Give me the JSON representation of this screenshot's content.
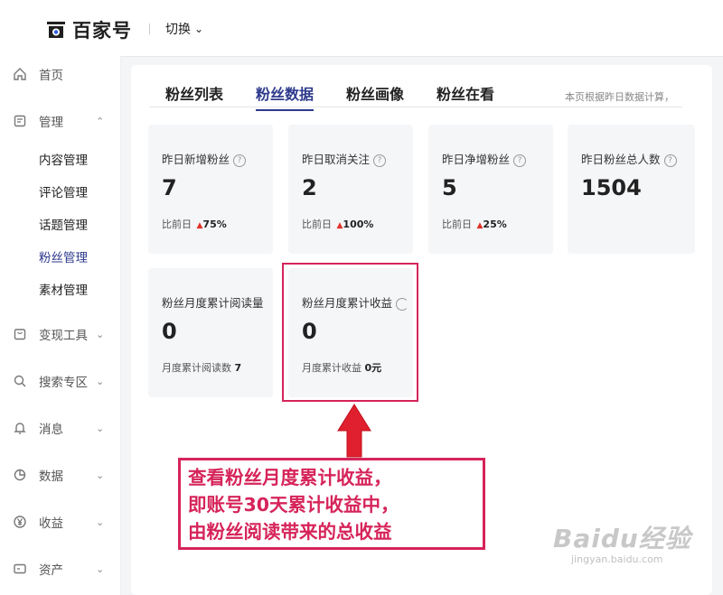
{
  "header": {
    "brand": "百家号",
    "switch_label": "切换"
  },
  "sidebar": {
    "home": "首页",
    "manage": "管理",
    "sub_items": [
      "内容管理",
      "评论管理",
      "话题管理",
      "粉丝管理",
      "素材管理"
    ],
    "monetize": "变现工具",
    "search": "搜索专区",
    "messages": "消息",
    "data": "数据",
    "income": "收益",
    "assets": "资产"
  },
  "tabs": [
    "粉丝列表",
    "粉丝数据",
    "粉丝画像",
    "粉丝在看"
  ],
  "active_tab": "粉丝数据",
  "note": "本页根据昨日数据计算，",
  "cards": [
    {
      "title": "昨日新增粉丝",
      "value": "7",
      "foot_label": "比前日",
      "foot_value": "75%"
    },
    {
      "title": "昨日取消关注",
      "value": "2",
      "foot_label": "比前日",
      "foot_value": "100%"
    },
    {
      "title": "昨日净增粉丝",
      "value": "5",
      "foot_label": "比前日",
      "foot_value": "25%"
    },
    {
      "title": "昨日粉丝总人数",
      "value": "1504"
    },
    {
      "title": "粉丝月度累计阅读量",
      "value": "0",
      "foot_label": "月度累计阅读数",
      "foot_value": "7"
    },
    {
      "title": "粉丝月度累计收益",
      "value": "0",
      "foot_label": "月度累计收益",
      "foot_value": "0元"
    }
  ],
  "callout": [
    "查看粉丝月度累计收益，",
    "即账号30天累计收益中，",
    "由粉丝阅读带来的总收益"
  ],
  "watermark": {
    "line1": "Baidu经验",
    "line2": "jingyan.baidu.com"
  },
  "colors": {
    "accent": "#2e3a8c",
    "highlight": "#d6245a",
    "up": "#e0312b"
  }
}
